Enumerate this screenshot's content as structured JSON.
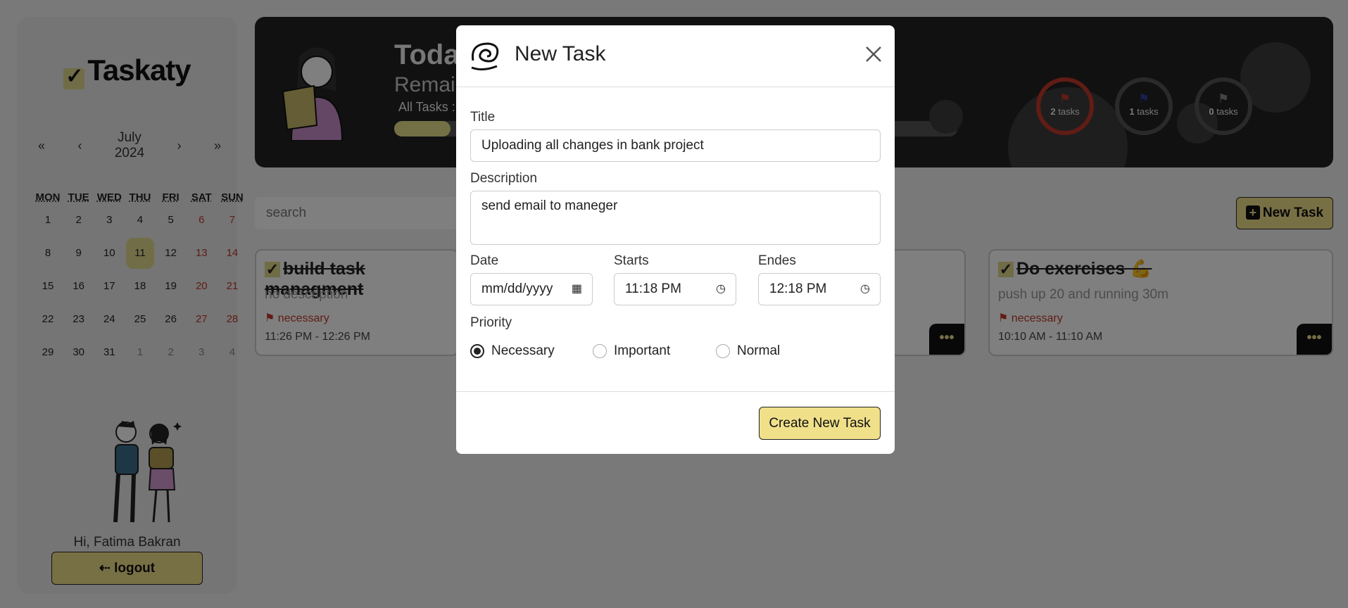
{
  "app": {
    "logo": "Taskaty"
  },
  "calendar": {
    "nav": {
      "first": "«",
      "prev": "‹",
      "next": "›",
      "last": "»"
    },
    "month": "July",
    "year": "2024",
    "weekdays": [
      "MON",
      "TUE",
      "WED",
      "THU",
      "FRI",
      "SAT",
      "SUN"
    ],
    "weeks": [
      [
        "1",
        "2",
        "3",
        "4",
        "5",
        "6",
        "7"
      ],
      [
        "8",
        "9",
        "10",
        "11",
        "12",
        "13",
        "14"
      ],
      [
        "15",
        "16",
        "17",
        "18",
        "19",
        "20",
        "21"
      ],
      [
        "22",
        "23",
        "24",
        "25",
        "26",
        "27",
        "28"
      ],
      [
        "29",
        "30",
        "31",
        "1",
        "2",
        "3",
        "4"
      ]
    ],
    "today": "11"
  },
  "user": {
    "greeting": "Hi, Fatima Bakran",
    "logout_label": "logout",
    "logout_icon": "⇠"
  },
  "banner": {
    "title": "Today",
    "subtitle": "Remain",
    "all_tasks_label": "All Tasks :",
    "progress": 0.1,
    "stats": [
      {
        "count": "2",
        "label": "tasks",
        "color": "#c0392b"
      },
      {
        "count": "1",
        "label": "tasks",
        "color": "#2c3e9e"
      },
      {
        "count": "0",
        "label": "tasks",
        "color": "#888888"
      }
    ]
  },
  "toolbar": {
    "search_placeholder": "search",
    "new_task_label": "New Task"
  },
  "cards": [
    {
      "title": "build task managment",
      "description": "no description",
      "priority": "necessary",
      "time": "11:26 PM - 12:26 PM",
      "more": "•••"
    },
    {
      "title": "Do exercises 💪",
      "description": "push up 20 and running 30m",
      "priority": "necessary",
      "time": "10:10 AM - 11:10 AM",
      "more": "•••"
    }
  ],
  "modal": {
    "title": "New Task",
    "title_label": "Title",
    "title_value": "Uploading all changes in bank project",
    "description_label": "Description",
    "description_value": "send email to maneger",
    "date_label": "Date",
    "date_value": "mm/dd/yyyy",
    "starts_label": "Starts",
    "starts_value": "11:18 PM",
    "ends_label": "Endes",
    "ends_value": "12:18 PM",
    "priority_label": "Priority",
    "priorities": [
      "Necessary",
      "Important",
      "Normal"
    ],
    "selected_priority": "Necessary",
    "submit_label": "Create New Task"
  },
  "colors": {
    "accent": "#f0e08a",
    "necessary": "#c0392b",
    "important": "#2c3e9e"
  }
}
